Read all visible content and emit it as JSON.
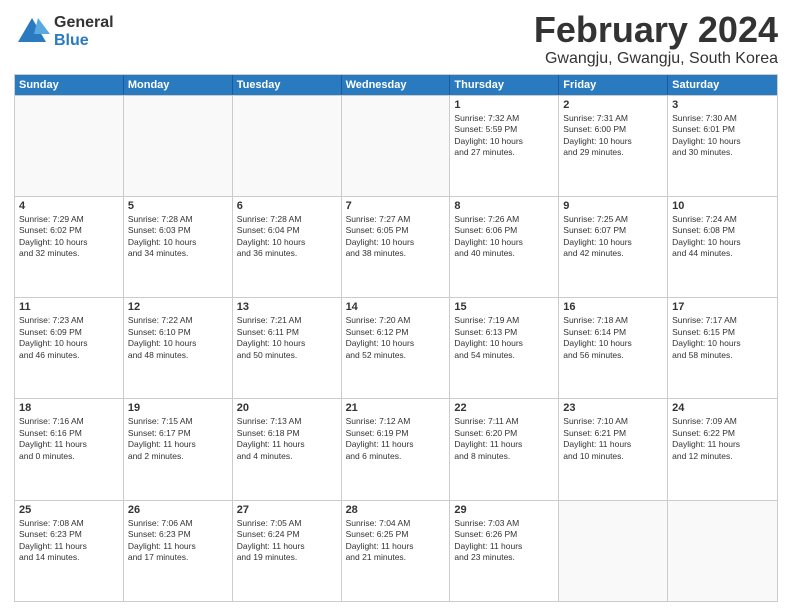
{
  "header": {
    "logo": {
      "general": "General",
      "blue": "Blue"
    },
    "title": "February 2024",
    "subtitle": "Gwangju, Gwangju, South Korea"
  },
  "calendar": {
    "days": [
      "Sunday",
      "Monday",
      "Tuesday",
      "Wednesday",
      "Thursday",
      "Friday",
      "Saturday"
    ],
    "rows": [
      [
        {
          "day": "",
          "info": ""
        },
        {
          "day": "",
          "info": ""
        },
        {
          "day": "",
          "info": ""
        },
        {
          "day": "",
          "info": ""
        },
        {
          "day": "1",
          "info": "Sunrise: 7:32 AM\nSunset: 5:59 PM\nDaylight: 10 hours\nand 27 minutes."
        },
        {
          "day": "2",
          "info": "Sunrise: 7:31 AM\nSunset: 6:00 PM\nDaylight: 10 hours\nand 29 minutes."
        },
        {
          "day": "3",
          "info": "Sunrise: 7:30 AM\nSunset: 6:01 PM\nDaylight: 10 hours\nand 30 minutes."
        }
      ],
      [
        {
          "day": "4",
          "info": "Sunrise: 7:29 AM\nSunset: 6:02 PM\nDaylight: 10 hours\nand 32 minutes."
        },
        {
          "day": "5",
          "info": "Sunrise: 7:28 AM\nSunset: 6:03 PM\nDaylight: 10 hours\nand 34 minutes."
        },
        {
          "day": "6",
          "info": "Sunrise: 7:28 AM\nSunset: 6:04 PM\nDaylight: 10 hours\nand 36 minutes."
        },
        {
          "day": "7",
          "info": "Sunrise: 7:27 AM\nSunset: 6:05 PM\nDaylight: 10 hours\nand 38 minutes."
        },
        {
          "day": "8",
          "info": "Sunrise: 7:26 AM\nSunset: 6:06 PM\nDaylight: 10 hours\nand 40 minutes."
        },
        {
          "day": "9",
          "info": "Sunrise: 7:25 AM\nSunset: 6:07 PM\nDaylight: 10 hours\nand 42 minutes."
        },
        {
          "day": "10",
          "info": "Sunrise: 7:24 AM\nSunset: 6:08 PM\nDaylight: 10 hours\nand 44 minutes."
        }
      ],
      [
        {
          "day": "11",
          "info": "Sunrise: 7:23 AM\nSunset: 6:09 PM\nDaylight: 10 hours\nand 46 minutes."
        },
        {
          "day": "12",
          "info": "Sunrise: 7:22 AM\nSunset: 6:10 PM\nDaylight: 10 hours\nand 48 minutes."
        },
        {
          "day": "13",
          "info": "Sunrise: 7:21 AM\nSunset: 6:11 PM\nDaylight: 10 hours\nand 50 minutes."
        },
        {
          "day": "14",
          "info": "Sunrise: 7:20 AM\nSunset: 6:12 PM\nDaylight: 10 hours\nand 52 minutes."
        },
        {
          "day": "15",
          "info": "Sunrise: 7:19 AM\nSunset: 6:13 PM\nDaylight: 10 hours\nand 54 minutes."
        },
        {
          "day": "16",
          "info": "Sunrise: 7:18 AM\nSunset: 6:14 PM\nDaylight: 10 hours\nand 56 minutes."
        },
        {
          "day": "17",
          "info": "Sunrise: 7:17 AM\nSunset: 6:15 PM\nDaylight: 10 hours\nand 58 minutes."
        }
      ],
      [
        {
          "day": "18",
          "info": "Sunrise: 7:16 AM\nSunset: 6:16 PM\nDaylight: 11 hours\nand 0 minutes."
        },
        {
          "day": "19",
          "info": "Sunrise: 7:15 AM\nSunset: 6:17 PM\nDaylight: 11 hours\nand 2 minutes."
        },
        {
          "day": "20",
          "info": "Sunrise: 7:13 AM\nSunset: 6:18 PM\nDaylight: 11 hours\nand 4 minutes."
        },
        {
          "day": "21",
          "info": "Sunrise: 7:12 AM\nSunset: 6:19 PM\nDaylight: 11 hours\nand 6 minutes."
        },
        {
          "day": "22",
          "info": "Sunrise: 7:11 AM\nSunset: 6:20 PM\nDaylight: 11 hours\nand 8 minutes."
        },
        {
          "day": "23",
          "info": "Sunrise: 7:10 AM\nSunset: 6:21 PM\nDaylight: 11 hours\nand 10 minutes."
        },
        {
          "day": "24",
          "info": "Sunrise: 7:09 AM\nSunset: 6:22 PM\nDaylight: 11 hours\nand 12 minutes."
        }
      ],
      [
        {
          "day": "25",
          "info": "Sunrise: 7:08 AM\nSunset: 6:23 PM\nDaylight: 11 hours\nand 14 minutes."
        },
        {
          "day": "26",
          "info": "Sunrise: 7:06 AM\nSunset: 6:23 PM\nDaylight: 11 hours\nand 17 minutes."
        },
        {
          "day": "27",
          "info": "Sunrise: 7:05 AM\nSunset: 6:24 PM\nDaylight: 11 hours\nand 19 minutes."
        },
        {
          "day": "28",
          "info": "Sunrise: 7:04 AM\nSunset: 6:25 PM\nDaylight: 11 hours\nand 21 minutes."
        },
        {
          "day": "29",
          "info": "Sunrise: 7:03 AM\nSunset: 6:26 PM\nDaylight: 11 hours\nand 23 minutes."
        },
        {
          "day": "",
          "info": ""
        },
        {
          "day": "",
          "info": ""
        }
      ]
    ]
  }
}
